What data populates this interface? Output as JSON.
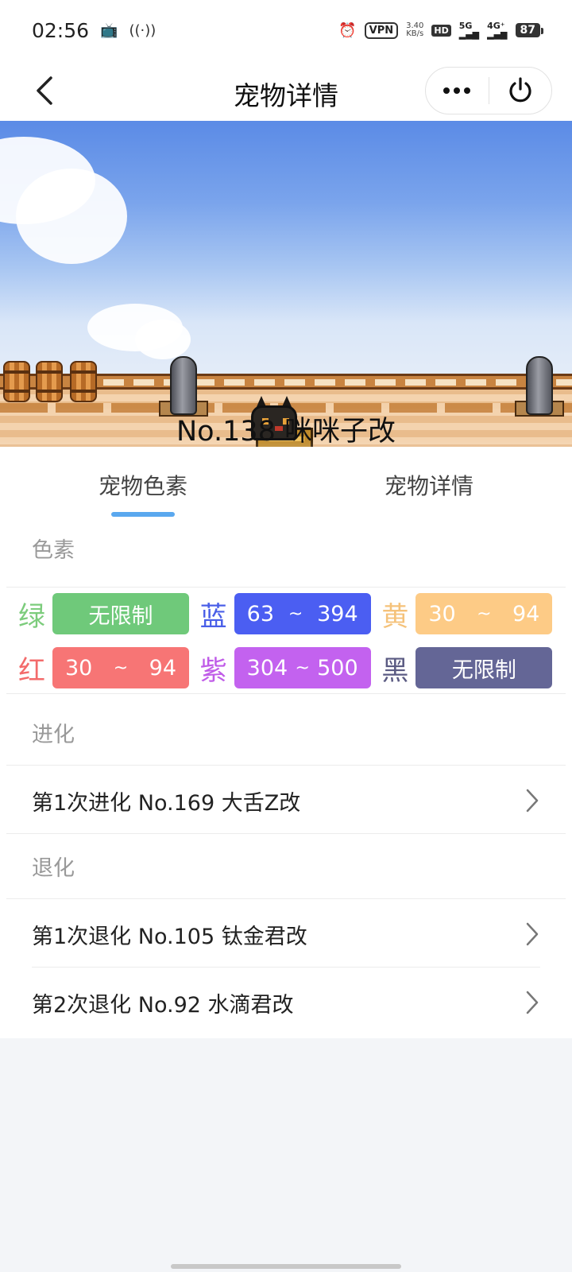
{
  "status_bar": {
    "time": "02:56",
    "vpn": "VPN",
    "speed_value": "3.40",
    "speed_unit": "KB/s",
    "hd": "HD",
    "net_5g": "5G",
    "net_4g": "4G⁺",
    "battery": "87"
  },
  "nav": {
    "title": "宠物详情"
  },
  "pet": {
    "name": "No.138 咪咪子改"
  },
  "tabs": [
    {
      "label": "宠物色素",
      "active": true
    },
    {
      "label": "宠物详情",
      "active": false
    }
  ],
  "pigment": {
    "section_title": "色素",
    "items": [
      {
        "label": "绿",
        "label_color": "#7ccc7c",
        "bg": "#6fc97a",
        "value": "无限制"
      },
      {
        "label": "蓝",
        "label_color": "#4a5fe8",
        "bg": "#4b5ef2",
        "min": "63",
        "tilde": "~",
        "max": "394"
      },
      {
        "label": "黄",
        "label_color": "#f5c27a",
        "bg": "#fdcb86",
        "min": "30",
        "tilde": "~",
        "max": "94"
      },
      {
        "label": "红",
        "label_color": "#f36b6b",
        "bg": "#f77575",
        "min": "30",
        "tilde": "~",
        "max": "94"
      },
      {
        "label": "紫",
        "label_color": "#c05ce8",
        "bg": "#c362ef",
        "min": "304",
        "tilde": "~",
        "max": "500"
      },
      {
        "label": "黑",
        "label_color": "#5a5a82",
        "bg": "#646696",
        "value": "无限制"
      }
    ]
  },
  "evolution": {
    "section_title": "进化",
    "items": [
      {
        "text": "第1次进化 No.169 大舌Z改"
      }
    ]
  },
  "devolution": {
    "section_title": "退化",
    "items": [
      {
        "text": "第1次退化 No.105 钛金君改"
      },
      {
        "text": "第2次退化 No.92 水滴君改"
      }
    ]
  },
  "colors": {
    "tab_indicator": "#5aa8ef",
    "page_background": "#f3f5f8"
  }
}
